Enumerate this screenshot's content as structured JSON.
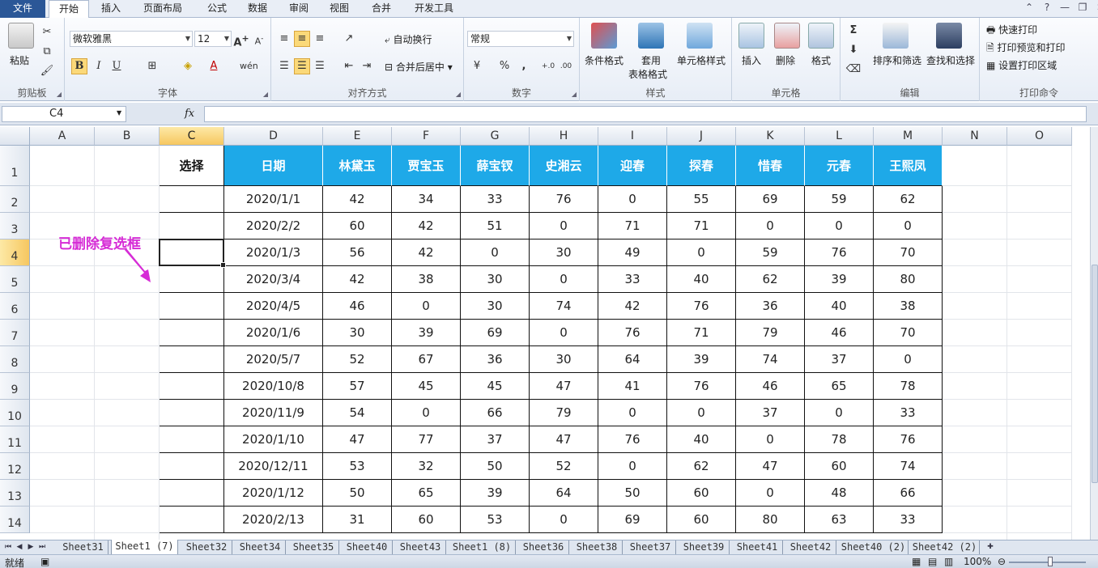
{
  "ribbon_tabs": [
    "文件",
    "开始",
    "插入",
    "页面布局",
    "公式",
    "数据",
    "审阅",
    "视图",
    "合并",
    "开发工具"
  ],
  "active_tab": "开始",
  "clipboard": {
    "paste": "粘贴",
    "label": "剪贴板"
  },
  "font": {
    "name": "微软雅黑",
    "size": "12",
    "label": "字体",
    "bold": "B",
    "italic": "I",
    "underline": "U"
  },
  "align": {
    "wrap": "自动换行",
    "merge": "合并后居中",
    "label": "对齐方式"
  },
  "number": {
    "format": "常规",
    "label": "数字",
    "percent": "%",
    "comma": ","
  },
  "styles": {
    "cond": "条件格式",
    "table1": "套用",
    "table2": "表格格式",
    "cell": "单元格样式",
    "label": "样式"
  },
  "cells": {
    "insert": "插入",
    "delete": "删除",
    "format": "格式",
    "label": "单元格"
  },
  "editing": {
    "sigma": "Σ",
    "sort": "排序和筛选",
    "find": "查找和选择",
    "label": "编辑"
  },
  "print": {
    "quick": "快速打印",
    "preview": "打印预览和打印",
    "area": "设置打印区域",
    "label": "打印命令"
  },
  "name_box": "C4",
  "fx": "fx",
  "columns": [
    "A",
    "B",
    "C",
    "D",
    "E",
    "F",
    "G",
    "H",
    "I",
    "J",
    "K",
    "L",
    "M",
    "N",
    "O"
  ],
  "rows": [
    "1",
    "2",
    "3",
    "4",
    "5",
    "6",
    "7",
    "8",
    "9",
    "10",
    "11",
    "12",
    "13",
    "14"
  ],
  "table": {
    "header": [
      "选择",
      "日期",
      "林黛玉",
      "贾宝玉",
      "薛宝钗",
      "史湘云",
      "迎春",
      "探春",
      "惜春",
      "元春",
      "王熙凤"
    ],
    "rows": [
      [
        "2020/1/1",
        "42",
        "34",
        "33",
        "76",
        "0",
        "55",
        "69",
        "59",
        "62"
      ],
      [
        "2020/2/2",
        "60",
        "42",
        "51",
        "0",
        "71",
        "71",
        "0",
        "0",
        "0"
      ],
      [
        "2020/1/3",
        "56",
        "42",
        "0",
        "30",
        "49",
        "0",
        "59",
        "76",
        "70"
      ],
      [
        "2020/3/4",
        "42",
        "38",
        "30",
        "0",
        "33",
        "40",
        "62",
        "39",
        "80"
      ],
      [
        "2020/4/5",
        "46",
        "0",
        "30",
        "74",
        "42",
        "76",
        "36",
        "40",
        "38"
      ],
      [
        "2020/1/6",
        "30",
        "39",
        "69",
        "0",
        "76",
        "71",
        "79",
        "46",
        "70"
      ],
      [
        "2020/5/7",
        "52",
        "67",
        "36",
        "30",
        "64",
        "39",
        "74",
        "37",
        "0"
      ],
      [
        "2020/10/8",
        "57",
        "45",
        "45",
        "47",
        "41",
        "76",
        "46",
        "65",
        "78"
      ],
      [
        "2020/11/9",
        "54",
        "0",
        "66",
        "79",
        "0",
        "0",
        "37",
        "0",
        "33"
      ],
      [
        "2020/1/10",
        "47",
        "77",
        "37",
        "47",
        "76",
        "40",
        "0",
        "78",
        "76"
      ],
      [
        "2020/12/11",
        "53",
        "32",
        "50",
        "52",
        "0",
        "62",
        "47",
        "60",
        "74"
      ],
      [
        "2020/1/12",
        "50",
        "65",
        "39",
        "64",
        "50",
        "60",
        "0",
        "48",
        "66"
      ],
      [
        "2020/2/13",
        "31",
        "60",
        "53",
        "0",
        "69",
        "60",
        "80",
        "63",
        "33"
      ]
    ]
  },
  "annotation": "已删除复选框",
  "sheet_tabs": [
    "Sheet31",
    "Sheet1 (7)",
    "Sheet32",
    "Sheet34",
    "Sheet35",
    "Sheet40",
    "Sheet43",
    "Sheet1 (8)",
    "Sheet36",
    "Sheet38",
    "Sheet37",
    "Sheet39",
    "Sheet41",
    "Sheet42",
    "Sheet40 (2)",
    "Sheet42 (2)"
  ],
  "active_sheet": "Sheet1 (7)",
  "status": {
    "ready": "就绪",
    "zoom": "100%"
  },
  "colors": {
    "header_fill": "#1ea9e8",
    "annotation": "#d62cd6",
    "selected_header": "#f6c760"
  }
}
